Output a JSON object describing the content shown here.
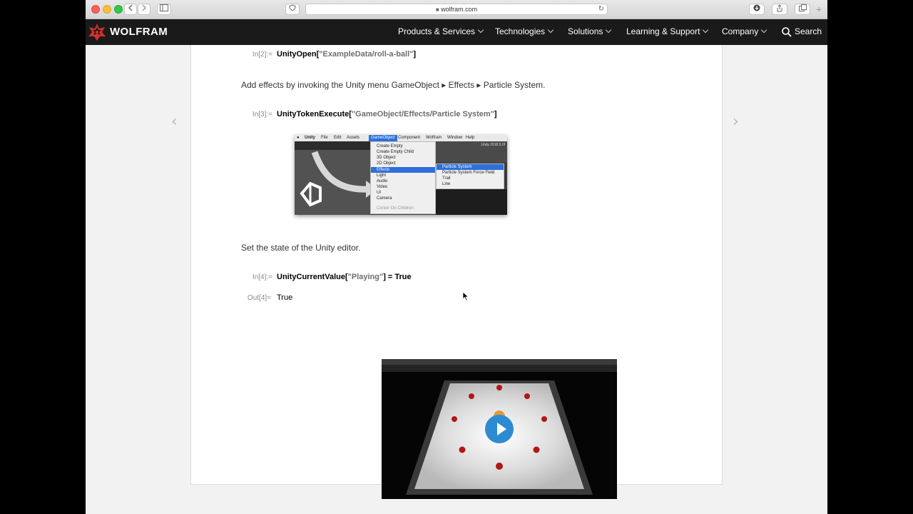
{
  "browser": {
    "url": "wolfram.com",
    "reload_glyph": "↻"
  },
  "header": {
    "logo_text": "WOLFRAM",
    "nav": [
      {
        "label": "Products & Services"
      },
      {
        "label": "Technologies"
      },
      {
        "label": "Solutions"
      },
      {
        "label": "Learning & Support"
      },
      {
        "label": "Company"
      }
    ],
    "search_label": "Search"
  },
  "notebook": {
    "cells": [
      {
        "label": "In[2]:=",
        "fn": "UnityOpen[",
        "str": "\"ExampleData/roll-a-ball\"",
        "close": "]"
      },
      {
        "label": "In[3]:=",
        "fn": "UnityTokenExecute[",
        "str": "\"GameObject/Effects/Particle System\"",
        "close": "]"
      },
      {
        "label": "In[4]:=",
        "fn": "UnityCurrentValue[",
        "str": "\"Playing\"",
        "close": "] = True"
      }
    ],
    "prose_1": "Add effects by invoking the Unity menu GameObject ▸ Effects ▸ Particle System.",
    "prose_2": "Set the state of the Unity editor.",
    "output_label": "Out[4]=",
    "output_value": "True"
  },
  "unity_menu": {
    "menubar": [
      "Unity",
      "File",
      "Edit",
      "Assets",
      "GameObject",
      "Component",
      "Wolfram",
      "Window",
      "Help"
    ],
    "version": "Unity 2018.3.0f",
    "items": [
      "Create Empty",
      "Create Empty Child",
      "3D Object",
      "2D Object",
      "Effects",
      "Light",
      "Audio",
      "Video",
      "UI",
      "Camera",
      "",
      "Center On Children"
    ],
    "selected_item": "Effects",
    "submenu": [
      "Particle System",
      "Particle System Force Field",
      "Trail",
      "Line"
    ],
    "selected_sub": "Particle System"
  }
}
